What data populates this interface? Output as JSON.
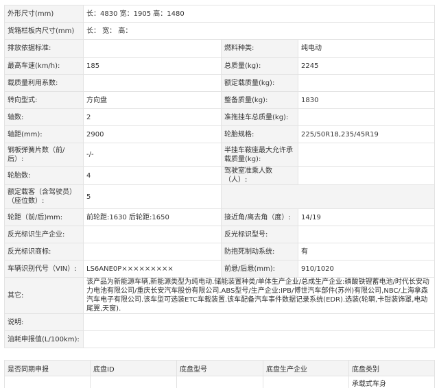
{
  "spec": {
    "outer_dims_label": "外形尺寸(mm)",
    "outer_dims_value": "长：4830 宽：1905 高：1480",
    "cargo_dims_label": "货箱栏板内尺寸(mm)",
    "cargo_dims_value": "长：  宽：  高：",
    "emission_label": "排放依据标准:",
    "emission_value": "",
    "fuel_label": "燃料种类:",
    "fuel_value": "纯电动",
    "max_speed_label": "最高车速(km/h):",
    "max_speed_value": "185",
    "total_mass_label": "总质量(kg):",
    "total_mass_value": "2245",
    "load_coef_label": "载质量利用系数:",
    "load_coef_value": "",
    "rated_load_label": "额定载质量(kg):",
    "rated_load_value": "",
    "steering_label": "转向型式:",
    "steering_value": "方向盘",
    "curb_mass_label": "整备质量(kg):",
    "curb_mass_value": "1830",
    "axles_label": "轴数:",
    "axles_value": "2",
    "trailer_mass_label": "准拖挂车总质量(kg):",
    "trailer_mass_value": "",
    "wheelbase_label": "轴距(mm):",
    "wheelbase_value": "2900",
    "tire_spec_label": "轮胎规格:",
    "tire_spec_value": "225/50R18,235/45R19",
    "leaf_spring_label": "钢板弹簧片数（前/后）:",
    "leaf_spring_value": "-/-",
    "semi_trailer_label": "半挂车鞍座最大允许承载质量(kg):",
    "semi_trailer_value": "",
    "tire_count_label": "轮胎数:",
    "tire_count_value": "4",
    "cab_passengers_label": "驾驶室准乘人数（人）:",
    "cab_passengers_value": "",
    "rated_passengers_label": "额定载客（含驾驶员）（座位数）:",
    "rated_passengers_value": "5",
    "track_label": "轮距（前/后)mm:",
    "track_value": "前轮距:1630 后轮距:1650",
    "approach_angle_label": "接近角/离去角（度）:",
    "approach_angle_value": "14/19",
    "reflector_maker_label": "反光标识生产企业:",
    "reflector_maker_value": "",
    "reflector_model_label": "反光标识型号:",
    "reflector_model_value": "",
    "reflector_brand_label": "反光标识商标:",
    "reflector_brand_value": "",
    "abs_label": "防抱死制动系统:",
    "abs_value": "有",
    "vin_label": "车辆识别代号（VIN）:",
    "vin_value": "LS6ANE0P×××××××××",
    "overhang_label": "前悬/后悬(mm):",
    "overhang_value": "910/1020",
    "other_label": "其它:",
    "other_value": "该产品为新能源车辆,新能源类型为纯电动.储能装置种类/单体生产企业/总成生产企业:磷酸铁锂蓄电池/时代长安动力电池有限公司/重庆长安汽车股份有限公司.ABS型号/生产企业:IPB/博世汽车部件(苏州)有限公司,NBC/上海拿森汽车电子有限公司.该车型可选装ETC车载装置.该车配备汽车事件数据记录系统(EDR).选装(轮辋,卡钳装饰罩,电动尾翼,天窗).",
    "note_label": "说明:",
    "note_value": "",
    "fuel_consumption_label": "油耗申报值(L/100km):",
    "fuel_consumption_value": ""
  },
  "chassis": {
    "headers": [
      "是否同期申报",
      "底盘ID",
      "底盘型号",
      "底盘生产企业",
      "底盘类别"
    ],
    "row": [
      "",
      "",
      "",
      "",
      "承载式车身"
    ]
  }
}
